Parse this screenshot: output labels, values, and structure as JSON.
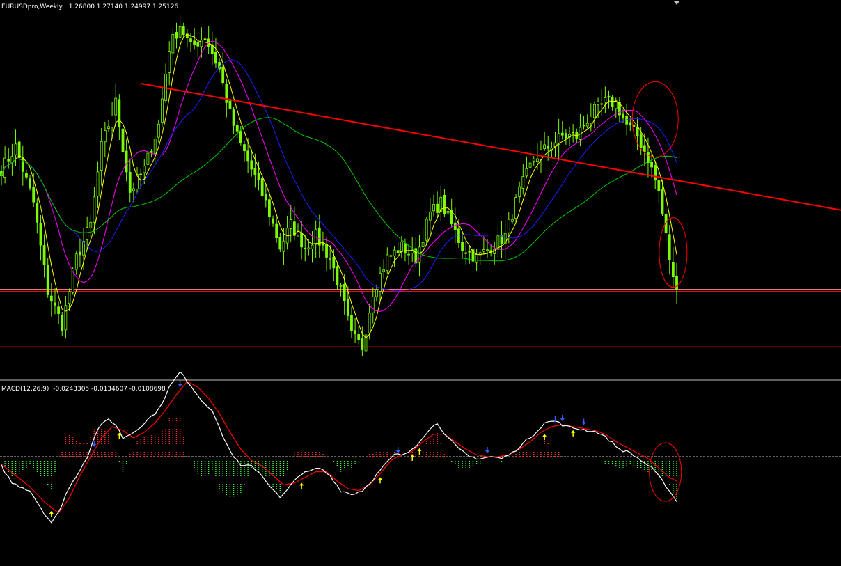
{
  "header": {
    "symbol_timeframe": "EURUSDpro,Weekly",
    "ohlc": "1.26800 1.27140 1.24997 1.25126"
  },
  "macd_header": {
    "label": "MACD(12,26,9)",
    "values": "-0.0243305 -0.0134607 -0.0108698"
  },
  "colors": {
    "background": "#000000",
    "candle": "#7CFC00",
    "trendline": "#ff0000",
    "support_lines": "#ff0000",
    "ma_fast": "#ffff00",
    "ma_mid": "#ff00ff",
    "ma_slow": "#1e1eff",
    "ma_long": "#00cc00",
    "circle": "#ff0000",
    "macd_line": "#ffffff",
    "signal_line": "#ff0000",
    "hist_pos": "#ff3030",
    "hist_neg": "#33ff33",
    "zero_line": "#c0c0c0",
    "arrow_up": "#ffff00",
    "arrow_down": "#3a5cff",
    "separator": "#c0c0c0"
  },
  "chart_data": [
    {
      "type": "candlestick",
      "title": "EURUSDpro,Weekly",
      "ohlc_label": "1.26800 1.27140 1.24997 1.25126",
      "bars": 190,
      "close_path": [
        [
          0,
          1.36
        ],
        [
          4,
          1.38
        ],
        [
          9,
          1.33
        ],
        [
          13,
          1.25
        ],
        [
          17,
          1.22
        ],
        [
          21,
          1.28
        ],
        [
          25,
          1.31
        ],
        [
          28,
          1.38
        ],
        [
          32,
          1.42
        ],
        [
          36,
          1.34
        ],
        [
          40,
          1.36
        ],
        [
          44,
          1.4
        ],
        [
          47,
          1.47
        ],
        [
          50,
          1.49
        ],
        [
          53,
          1.47
        ],
        [
          57,
          1.48
        ],
        [
          61,
          1.45
        ],
        [
          64,
          1.41
        ],
        [
          66,
          1.39
        ],
        [
          70,
          1.36
        ],
        [
          74,
          1.33
        ],
        [
          78,
          1.29
        ],
        [
          81,
          1.31
        ],
        [
          85,
          1.29
        ],
        [
          88,
          1.3
        ],
        [
          92,
          1.28
        ],
        [
          95,
          1.25
        ],
        [
          98,
          1.21
        ],
        [
          101,
          1.2
        ],
        [
          104,
          1.25
        ],
        [
          108,
          1.28
        ],
        [
          112,
          1.29
        ],
        [
          116,
          1.28
        ],
        [
          120,
          1.32
        ],
        [
          123,
          1.33
        ],
        [
          126,
          1.31
        ],
        [
          129,
          1.29
        ],
        [
          133,
          1.28
        ],
        [
          137,
          1.29
        ],
        [
          141,
          1.3
        ],
        [
          145,
          1.34
        ],
        [
          149,
          1.37
        ],
        [
          153,
          1.38
        ],
        [
          157,
          1.39
        ],
        [
          161,
          1.39
        ],
        [
          165,
          1.41
        ],
        [
          169,
          1.42
        ],
        [
          172,
          1.42
        ],
        [
          175,
          1.4
        ],
        [
          178,
          1.39
        ],
        [
          181,
          1.37
        ],
        [
          184,
          1.34
        ],
        [
          186,
          1.3
        ],
        [
          188,
          1.26
        ],
        [
          189,
          1.25
        ]
      ],
      "trendline": {
        "start": [
          0,
          1.46
        ],
        "end": [
          189,
          1.35
        ]
      },
      "support_lines": [
        1.25,
        1.2
      ],
      "moving_averages": [
        "yellow",
        "magenta",
        "blue",
        "green"
      ],
      "annotations": [
        "circle",
        "circle"
      ]
    },
    {
      "type": "macd",
      "title": "MACD(12,26,9)",
      "values": [
        -0.0243305,
        -0.0134607,
        -0.0108698
      ],
      "macd_path": [
        [
          0,
          -0.005
        ],
        [
          3,
          -0.014
        ],
        [
          8,
          -0.018
        ],
        [
          12,
          -0.03
        ],
        [
          14,
          -0.035
        ],
        [
          16,
          -0.03
        ],
        [
          18,
          -0.02
        ],
        [
          21,
          -0.01
        ],
        [
          24,
          0.0
        ],
        [
          27,
          0.015
        ],
        [
          30,
          0.02
        ],
        [
          32,
          0.017
        ],
        [
          34,
          0.01
        ],
        [
          37,
          0.013
        ],
        [
          40,
          0.018
        ],
        [
          44,
          0.025
        ],
        [
          47,
          0.037
        ],
        [
          50,
          0.045
        ],
        [
          53,
          0.038
        ],
        [
          56,
          0.03
        ],
        [
          59,
          0.025
        ],
        [
          61,
          0.015
        ],
        [
          64,
          0.003
        ],
        [
          67,
          -0.005
        ],
        [
          70,
          -0.005
        ],
        [
          72,
          -0.008
        ],
        [
          75,
          -0.015
        ],
        [
          78,
          -0.022
        ],
        [
          80,
          -0.018
        ],
        [
          83,
          -0.01
        ],
        [
          86,
          -0.008
        ],
        [
          89,
          -0.006
        ],
        [
          92,
          -0.01
        ],
        [
          95,
          -0.018
        ],
        [
          98,
          -0.02
        ],
        [
          101,
          -0.018
        ],
        [
          104,
          -0.012
        ],
        [
          107,
          -0.005
        ],
        [
          110,
          0.001
        ],
        [
          113,
          0.001
        ],
        [
          116,
          0.006
        ],
        [
          119,
          0.013
        ],
        [
          122,
          0.018
        ],
        [
          125,
          0.01
        ],
        [
          128,
          0.004
        ],
        [
          131,
          0.0
        ],
        [
          134,
          -0.001
        ],
        [
          137,
          0.0
        ],
        [
          140,
          -0.001
        ],
        [
          143,
          0.002
        ],
        [
          146,
          0.007
        ],
        [
          149,
          0.012
        ],
        [
          152,
          0.018
        ],
        [
          155,
          0.019
        ],
        [
          158,
          0.016
        ],
        [
          161,
          0.015
        ],
        [
          164,
          0.014
        ],
        [
          167,
          0.013
        ],
        [
          170,
          0.009
        ],
        [
          173,
          0.004
        ],
        [
          176,
          0.002
        ],
        [
          179,
          -0.002
        ],
        [
          182,
          -0.006
        ],
        [
          185,
          -0.013
        ],
        [
          187,
          -0.018
        ],
        [
          189,
          -0.024
        ]
      ],
      "signal_path": [
        [
          0,
          -0.004
        ],
        [
          4,
          -0.01
        ],
        [
          8,
          -0.016
        ],
        [
          12,
          -0.024
        ],
        [
          16,
          -0.03
        ],
        [
          19,
          -0.022
        ],
        [
          22,
          -0.01
        ],
        [
          25,
          0.0
        ],
        [
          28,
          0.01
        ],
        [
          31,
          0.016
        ],
        [
          34,
          0.014
        ],
        [
          37,
          0.01
        ],
        [
          40,
          0.013
        ],
        [
          43,
          0.018
        ],
        [
          46,
          0.025
        ],
        [
          49,
          0.033
        ],
        [
          52,
          0.04
        ],
        [
          55,
          0.037
        ],
        [
          58,
          0.031
        ],
        [
          61,
          0.023
        ],
        [
          64,
          0.013
        ],
        [
          67,
          0.004
        ],
        [
          70,
          -0.002
        ],
        [
          73,
          -0.005
        ],
        [
          76,
          -0.01
        ],
        [
          79,
          -0.015
        ],
        [
          82,
          -0.014
        ],
        [
          85,
          -0.011
        ],
        [
          88,
          -0.008
        ],
        [
          91,
          -0.008
        ],
        [
          94,
          -0.013
        ],
        [
          97,
          -0.017
        ],
        [
          100,
          -0.018
        ],
        [
          103,
          -0.015
        ],
        [
          106,
          -0.009
        ],
        [
          109,
          -0.002
        ],
        [
          112,
          0.001
        ],
        [
          115,
          0.003
        ],
        [
          118,
          0.008
        ],
        [
          121,
          0.012
        ],
        [
          124,
          0.012
        ],
        [
          127,
          0.008
        ],
        [
          130,
          0.004
        ],
        [
          133,
          0.001
        ],
        [
          136,
          0.0
        ],
        [
          139,
          0.0
        ],
        [
          142,
          0.001
        ],
        [
          145,
          0.004
        ],
        [
          148,
          0.008
        ],
        [
          151,
          0.013
        ],
        [
          154,
          0.016
        ],
        [
          157,
          0.017
        ],
        [
          160,
          0.016
        ],
        [
          163,
          0.015
        ],
        [
          166,
          0.014
        ],
        [
          169,
          0.012
        ],
        [
          172,
          0.008
        ],
        [
          175,
          0.005
        ],
        [
          178,
          0.002
        ],
        [
          181,
          -0.001
        ],
        [
          184,
          -0.006
        ],
        [
          187,
          -0.011
        ],
        [
          189,
          -0.013
        ]
      ],
      "up_arrows_at": [
        14,
        33,
        84,
        106,
        115,
        117,
        152,
        160
      ],
      "down_arrows_at": [
        26,
        50,
        111,
        136,
        155,
        157,
        163
      ]
    }
  ]
}
